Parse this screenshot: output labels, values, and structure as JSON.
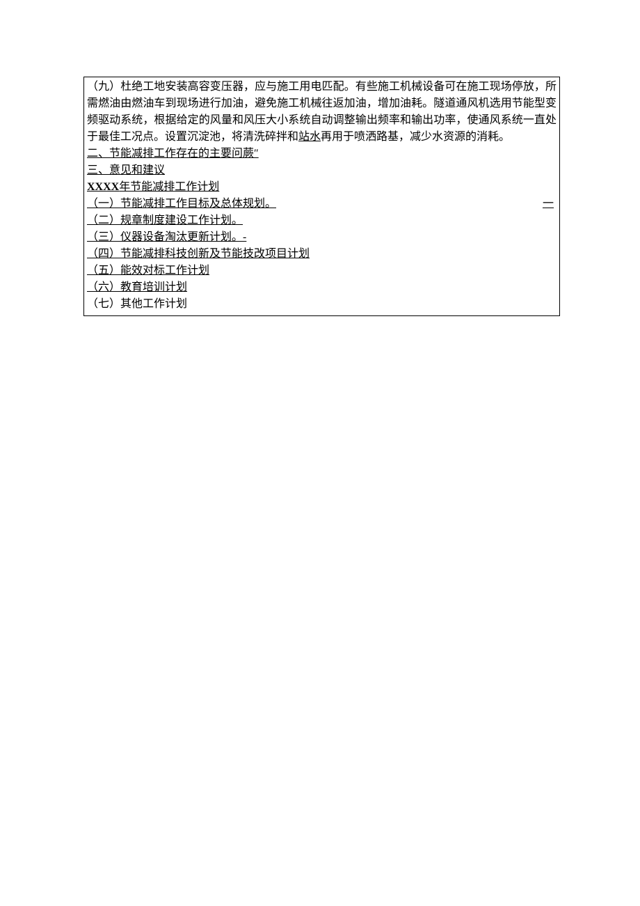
{
  "para_main": "（九）杜绝工地安装高容变压器，应与施工用电匹配。有些施工机械设备可在施工现场停放，所需燃油由燃油车到现场进行加油，避免施工机械往返加油，增加油耗。隧道通风机选用节能型变频驱动系统，根据给定的风量和风压大小系统自动调整输出频率和输出功率，使通风系统一直处于最佳工况点。设置沉淀池，将清洗碎拌和",
  "para_main_tail": "再用于喷洒路基，减少水资源的消耗。",
  "para_main_underword": "站水",
  "section2": "二、节能减排工作存在的主要问蕨″",
  "section3": "三、意见和建议",
  "plan_title_prefix": "XXXX",
  "plan_title_rest": "年节能减排工作计划",
  "items": {
    "i1": "（一）节能减排工作目标及总体规划。",
    "i1_trailer": "一",
    "i2": "（二）规章制度建设工作计划。",
    "i3": "（三）仪器设备淘汰更新计划。-",
    "i4": "（四）节能减排科技创新及节能技改项目计划",
    "i5": "（五）能效对标工作计划",
    "i6": "（六）教育培训计划",
    "i7": "（七）其他工作计划"
  }
}
